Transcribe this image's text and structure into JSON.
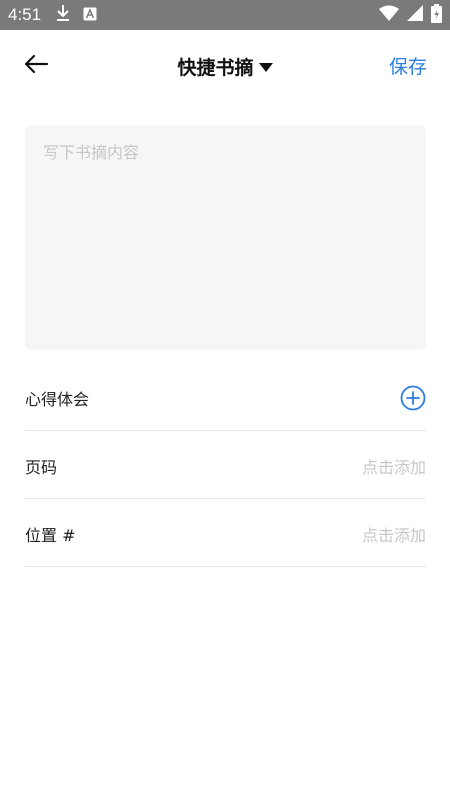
{
  "status_bar": {
    "time": "4:51"
  },
  "header": {
    "title": "快捷书摘",
    "save_label": "保存"
  },
  "excerpt": {
    "placeholder": "写下书摘内容"
  },
  "rows": {
    "thoughts_label": "心得体会",
    "page_label": "页码",
    "page_hint": "点击添加",
    "location_label": "位置 #",
    "location_hint": "点击添加"
  },
  "colors": {
    "accent": "#2a7de1",
    "status_bar_bg": "#7a7a7a",
    "input_bg": "#f5f6f8",
    "hint_text": "#c4c6ca"
  },
  "icons": {
    "back": "arrow-left-icon",
    "caret": "caret-down-icon",
    "add": "plus-circle-icon",
    "download": "download-icon",
    "a_badge": "a-badge-icon",
    "wifi": "wifi-icon",
    "signal": "signal-icon",
    "battery": "battery-icon"
  }
}
